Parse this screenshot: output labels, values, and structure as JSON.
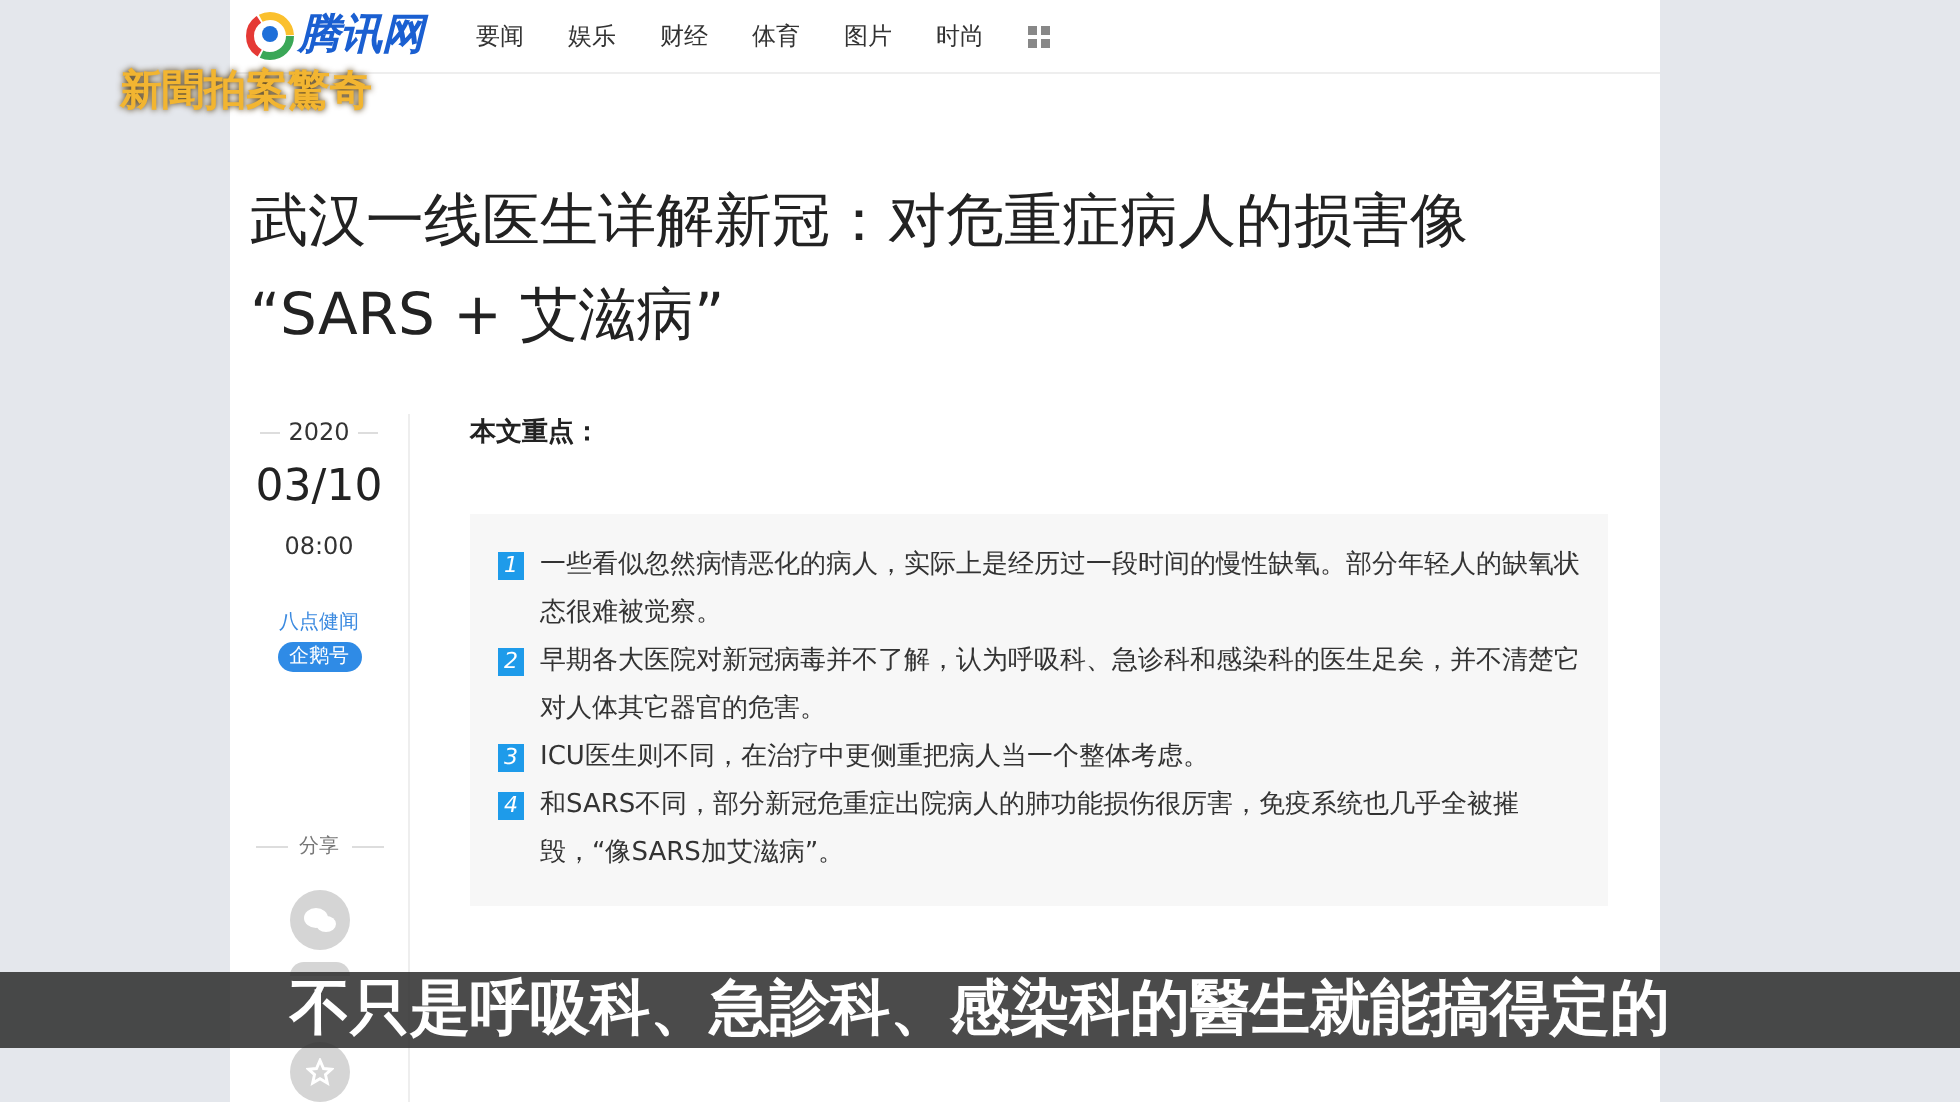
{
  "channel_label": "新聞拍案驚奇",
  "site": {
    "logo_text": "腾讯网",
    "nav": [
      {
        "label": "要闻"
      },
      {
        "label": "娱乐"
      },
      {
        "label": "财经"
      },
      {
        "label": "体育"
      },
      {
        "label": "图片"
      },
      {
        "label": "时尚"
      }
    ]
  },
  "article": {
    "title_lines": [
      "武汉一线医生详解新冠：对危重症病人的损害像",
      "“SARS + 艾滋病”"
    ],
    "date": {
      "year": "2020",
      "day": "03/10",
      "time": "08:00"
    },
    "author": {
      "name": "八点健闻",
      "badge": "企鹅号"
    },
    "share_label": "分享",
    "summary_heading": "本文重点：",
    "key_points": [
      {
        "number": "1",
        "text": "一些看似忽然病情恶化的病人，实际上是经历过一段时间的慢性缺氧。部分年轻人的缺氧状态很难被觉察。"
      },
      {
        "number": "2",
        "text": "早期各大医院对新冠病毒并不了解，认为呼吸科、急诊科和感染科的医生足矣，并不清楚它对人体其它器官的危害。"
      },
      {
        "number": "3",
        "text": "ICU医生则不同，在治疗中更侧重把病人当一个整体考虑。"
      },
      {
        "number": "4",
        "text": "和SARS不同，部分新冠危重症出院病人的肺功能损伤很厉害，免疫系统也几乎全被摧毁，“像SARS加艾滋病”。"
      }
    ]
  },
  "subtitle": "不只是呼吸科、急診科、感染科的醫生就能搞得定的"
}
